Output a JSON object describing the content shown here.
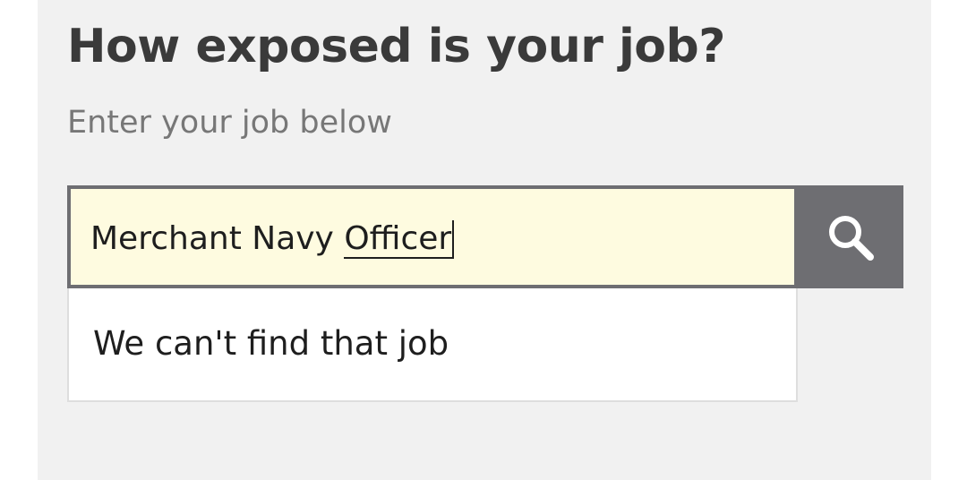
{
  "heading": {
    "title": "How exposed is your job?",
    "subtitle": "Enter your job below"
  },
  "search": {
    "value_prefix": "Merchant Navy ",
    "value_typed": "Officer",
    "button_icon": "search-icon"
  },
  "results": {
    "message": "We can't find that job"
  },
  "colors": {
    "panel_bg": "#f1f1f1",
    "input_bg": "#fefbe0",
    "button_bg": "#6e6e72",
    "title_text": "#3a3a3a",
    "subtitle_text": "#777777"
  }
}
